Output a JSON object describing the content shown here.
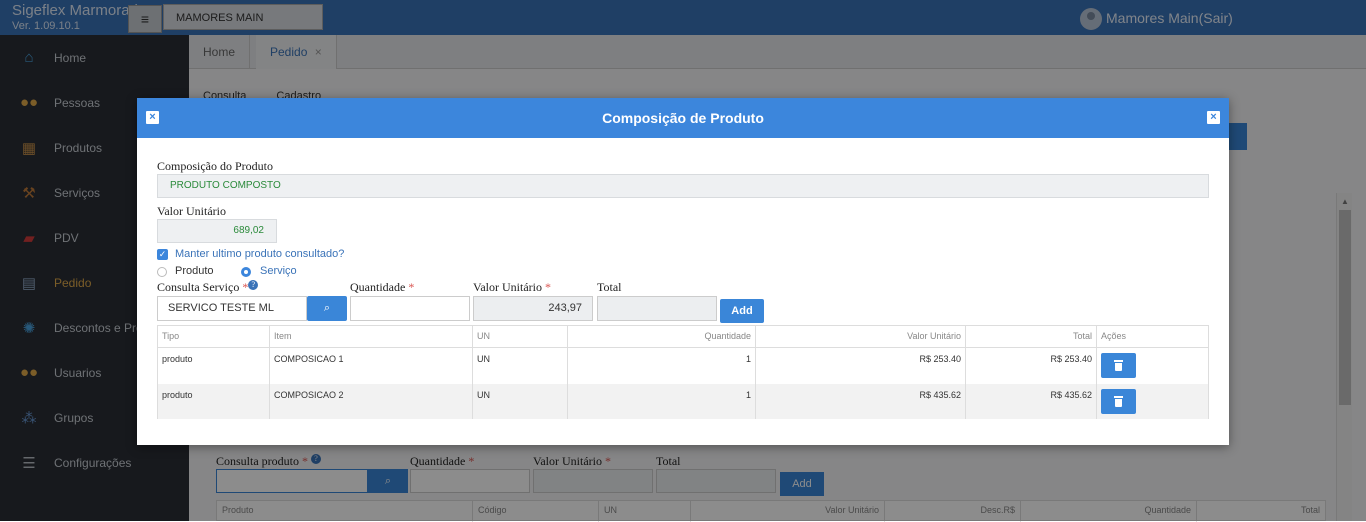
{
  "header": {
    "brand_name": "Sigeflex Marmoraria",
    "version": "Ver. 1.09.10.1",
    "menu_glyph": "≡",
    "app_select": "MAMORES MAIN",
    "user_label": "Mamores Main(Sair)"
  },
  "sidebar": {
    "items": [
      {
        "label": "Home",
        "icon": "home-icon"
      },
      {
        "label": "Pessoas",
        "icon": "people-icon"
      },
      {
        "label": "Produtos",
        "icon": "boxes-icon"
      },
      {
        "label": "Serviços",
        "icon": "hammer-icon"
      },
      {
        "label": "PDV",
        "icon": "cash-register-icon"
      },
      {
        "label": "Pedido",
        "icon": "order-icon"
      },
      {
        "label": "Descontos e Promoções",
        "icon": "discount-icon"
      },
      {
        "label": "Usuarios",
        "icon": "users-icon"
      },
      {
        "label": "Grupos",
        "icon": "groups-icon"
      },
      {
        "label": "Configurações",
        "icon": "settings-icon"
      }
    ]
  },
  "tabs": {
    "home": "Home",
    "pedido": "Pedido",
    "close_glyph": "×"
  },
  "subtabs": {
    "consulta": "Consulta",
    "cadastro": "Cadastro"
  },
  "background_form": {
    "consulta_produto": "Consulta produto",
    "quantidade": "Quantidade",
    "valor_unitario": "Valor Unitário",
    "total": "Total",
    "add": "Add",
    "req": "*",
    "help": "?",
    "grid_headers": [
      "Produto",
      "Código",
      "UN",
      "Valor Unitário",
      "Desc.R$",
      "Quantidade",
      "Total"
    ]
  },
  "modal": {
    "title": "Composição de Produto",
    "close_glyph": "×",
    "composicao_label": "Composição do Produto",
    "composicao_value": "PRODUTO COMPOSTO",
    "valor_unitario_label": "Valor Unitário",
    "valor_unitario_value": "689,02",
    "manter_label": "Manter ultimo produto consultado?",
    "check_glyph": "✓",
    "radio_produto": "Produto",
    "radio_servico": "Serviço",
    "consulta_servico_label": "Consulta Serviço",
    "req": "*",
    "help": "?",
    "consulta_servico_value": "SERVICO TESTE ML",
    "quantidade_label": "Quantidade",
    "quantidade_value": "",
    "valor_unitario2_label": "Valor Unitário",
    "valor_unitario2_value": "243,97",
    "total_label": "Total",
    "total_value": "",
    "add": "Add",
    "table": {
      "headers": [
        "Tipo",
        "Item",
        "UN",
        "Quantidade",
        "Valor Unitário",
        "Total",
        "Ações"
      ],
      "rows": [
        {
          "tipo": "produto",
          "item": "COMPOSICAO 1",
          "un": "UN",
          "quantidade": "1",
          "valor": "R$ 253.40",
          "total": "R$ 253.40"
        },
        {
          "tipo": "produto",
          "item": "COMPOSICAO 2",
          "un": "UN",
          "quantidade": "1",
          "valor": "R$ 435.62",
          "total": "R$ 435.62"
        }
      ]
    }
  }
}
